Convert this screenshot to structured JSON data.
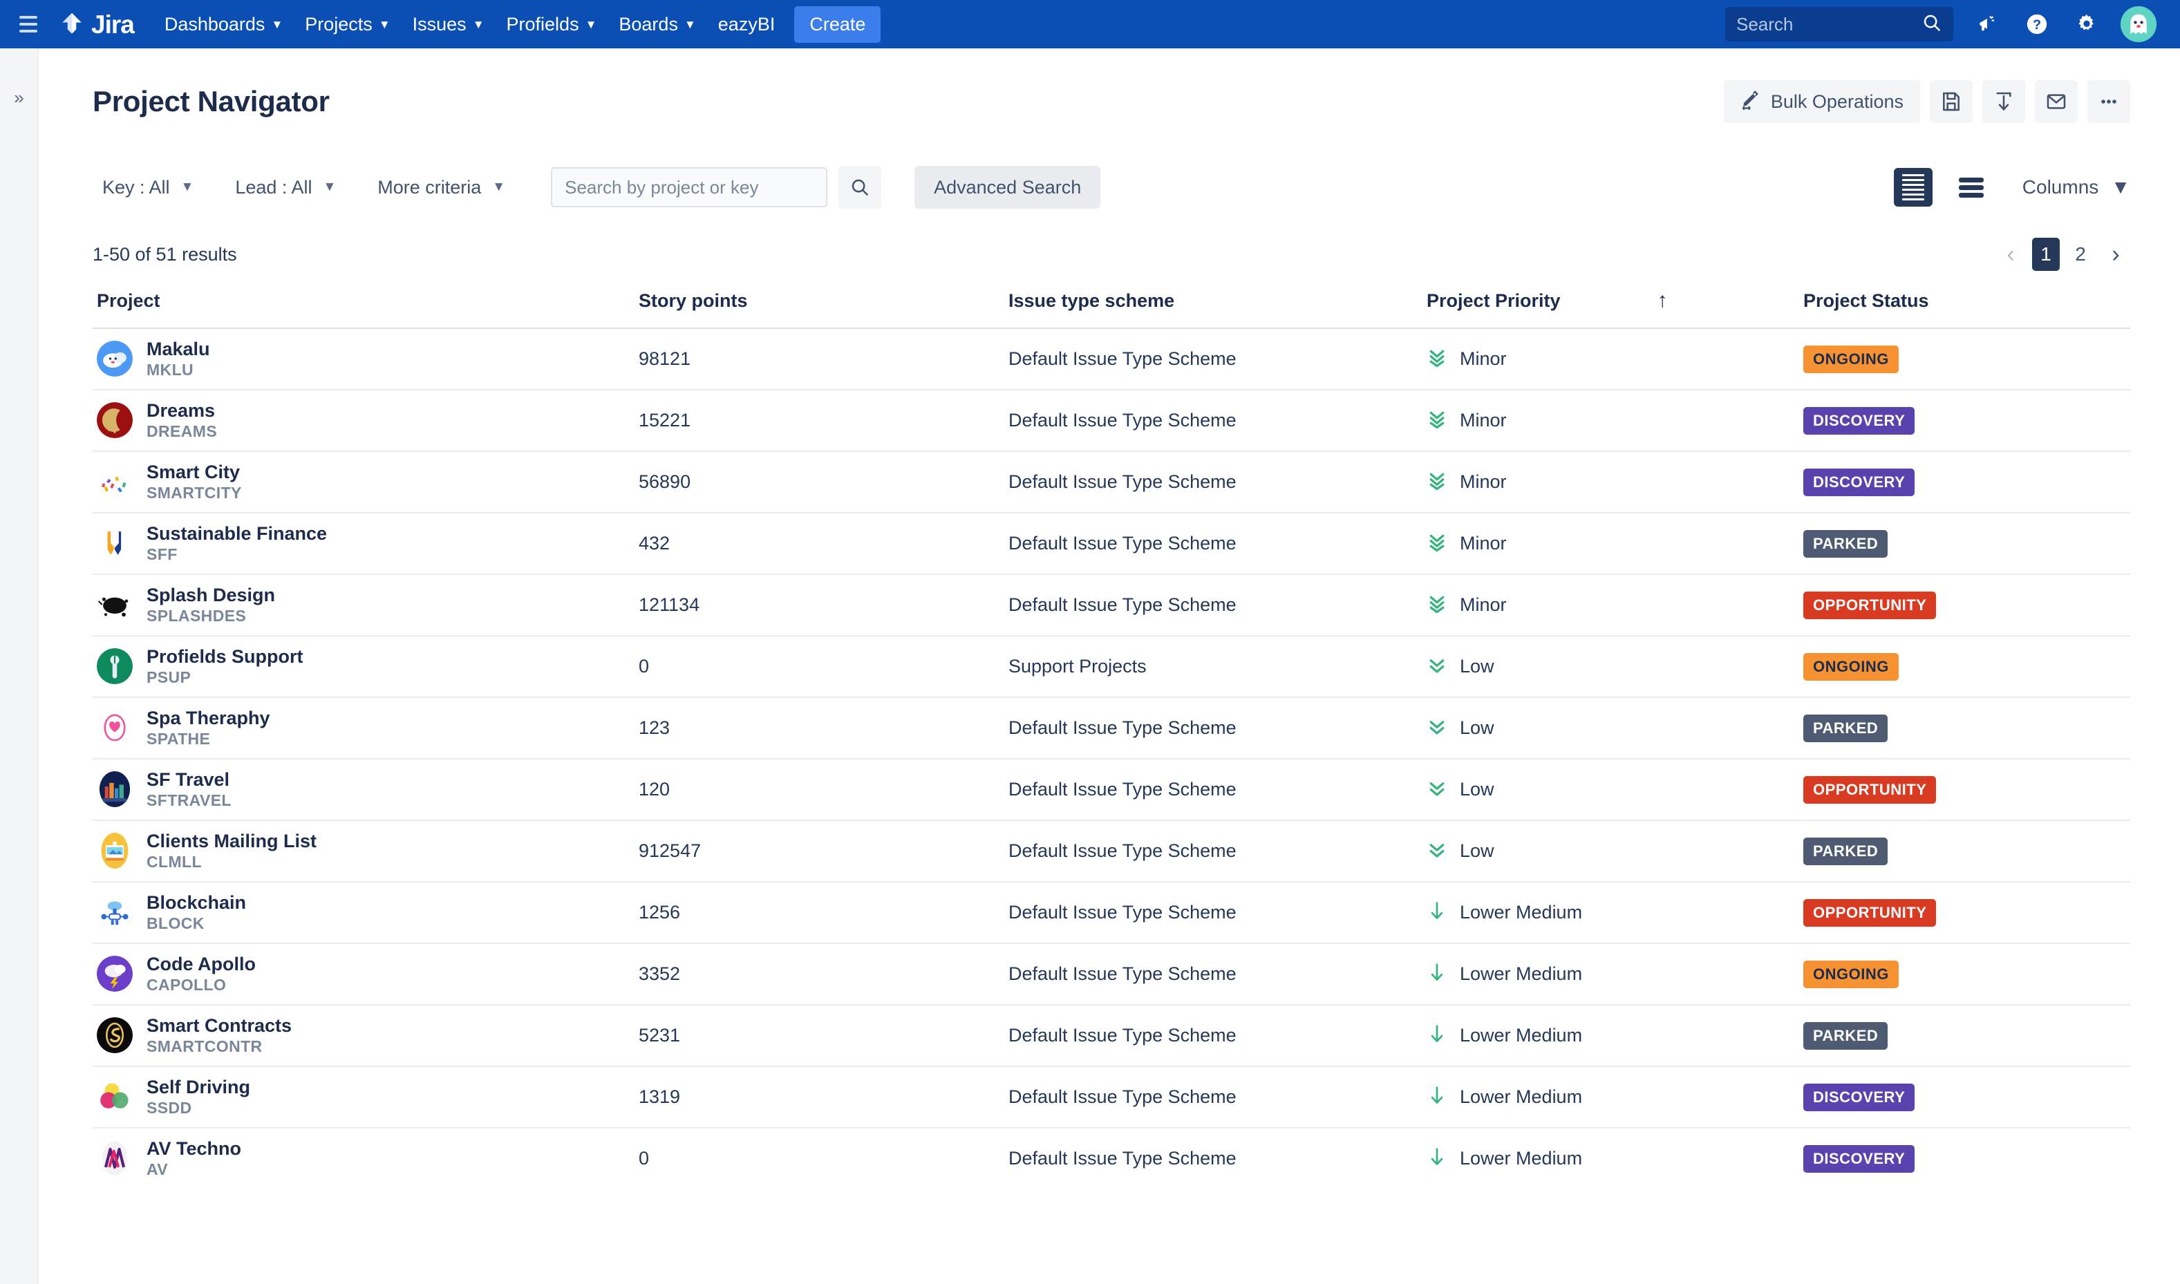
{
  "topnav": {
    "logo_text": "Jira",
    "items": [
      {
        "label": "Dashboards",
        "has_caret": true
      },
      {
        "label": "Projects",
        "has_caret": true
      },
      {
        "label": "Issues",
        "has_caret": true
      },
      {
        "label": "Profields",
        "has_caret": true
      },
      {
        "label": "Boards",
        "has_caret": true
      },
      {
        "label": "eazyBI",
        "has_caret": false
      }
    ],
    "create_label": "Create",
    "search_placeholder": "Search",
    "search_value": "",
    "icons": [
      "megaphone-icon",
      "help-icon",
      "gear-icon",
      "avatar"
    ]
  },
  "leftrail": {
    "expand_glyph": "»"
  },
  "header": {
    "title": "Project Navigator",
    "bulk_operations_label": "Bulk Operations",
    "icon_buttons": [
      "save-icon",
      "export-icon",
      "email-icon",
      "more-icon"
    ]
  },
  "filters": {
    "key": "Key : All",
    "lead": "Lead : All",
    "more": "More criteria",
    "search_placeholder": "Search by project or key",
    "search_value": "",
    "advanced_search": "Advanced Search",
    "columns": "Columns",
    "view_compact_active": true
  },
  "results": {
    "count_text": "1-50 of 51 results",
    "pages": [
      "1",
      "2"
    ],
    "active_page": "1"
  },
  "table": {
    "columns": [
      "Project",
      "Story points",
      "Issue type scheme",
      "Project Priority",
      "Project Status"
    ],
    "sort_column": "Project Priority",
    "sort_direction": "↑",
    "rows": [
      {
        "name": "Makalu",
        "key": "MKLU",
        "points": "98121",
        "scheme": "Default Issue Type Scheme",
        "priority": "Minor",
        "priority_icon": "triple-chevron-down-icon",
        "status": "ONGOING",
        "avatar": "cloud-blue"
      },
      {
        "name": "Dreams",
        "key": "DREAMS",
        "points": "15221",
        "scheme": "Default Issue Type Scheme",
        "priority": "Minor",
        "priority_icon": "triple-chevron-down-icon",
        "status": "DISCOVERY",
        "avatar": "moon-red"
      },
      {
        "name": "Smart City",
        "key": "SMARTCITY",
        "points": "56890",
        "scheme": "Default Issue Type Scheme",
        "priority": "Minor",
        "priority_icon": "triple-chevron-down-icon",
        "status": "DISCOVERY",
        "avatar": "confetti"
      },
      {
        "name": "Sustainable Finance",
        "key": "SFF",
        "points": "432",
        "scheme": "Default Issue Type Scheme",
        "priority": "Minor",
        "priority_icon": "triple-chevron-down-icon",
        "status": "PARKED",
        "avatar": "ribbon-blue-yellow"
      },
      {
        "name": "Splash Design",
        "key": "SPLASHDES",
        "points": "121134",
        "scheme": "Default Issue Type Scheme",
        "priority": "Minor",
        "priority_icon": "triple-chevron-down-icon",
        "status": "OPPORTUNITY",
        "avatar": "splash-black"
      },
      {
        "name": "Profields Support",
        "key": "PSUP",
        "points": "0",
        "scheme": "Support Projects",
        "priority": "Low",
        "priority_icon": "double-chevron-down-icon",
        "status": "ONGOING",
        "avatar": "wrench-green"
      },
      {
        "name": "Spa Theraphy",
        "key": "SPATHE",
        "points": "123",
        "scheme": "Default Issue Type Scheme",
        "priority": "Low",
        "priority_icon": "double-chevron-down-icon",
        "status": "PARKED",
        "avatar": "spa-pink"
      },
      {
        "name": "SF Travel",
        "key": "SFTRAVEL",
        "points": "120",
        "scheme": "Default Issue Type Scheme",
        "priority": "Low",
        "priority_icon": "double-chevron-down-icon",
        "status": "OPPORTUNITY",
        "avatar": "city-navy"
      },
      {
        "name": "Clients Mailing List",
        "key": "CLMLL",
        "points": "912547",
        "scheme": "Default Issue Type Scheme",
        "priority": "Low",
        "priority_icon": "double-chevron-down-icon",
        "status": "PARKED",
        "avatar": "mail-yellow"
      },
      {
        "name": "Blockchain",
        "key": "BLOCK",
        "points": "1256",
        "scheme": "Default Issue Type Scheme",
        "priority": "Lower Medium",
        "priority_icon": "arrow-down-icon",
        "status": "OPPORTUNITY",
        "avatar": "chain-blue"
      },
      {
        "name": "Code Apollo",
        "key": "CAPOLLO",
        "points": "3352",
        "scheme": "Default Issue Type Scheme",
        "priority": "Lower Medium",
        "priority_icon": "arrow-down-icon",
        "status": "ONGOING",
        "avatar": "storm-purple"
      },
      {
        "name": "Smart Contracts",
        "key": "SMARTCONTR",
        "points": "5231",
        "scheme": "Default Issue Type Scheme",
        "priority": "Lower Medium",
        "priority_icon": "arrow-down-icon",
        "status": "PARKED",
        "avatar": "coin-black"
      },
      {
        "name": "Self Driving",
        "key": "SSDD",
        "points": "1319",
        "scheme": "Default Issue Type Scheme",
        "priority": "Lower Medium",
        "priority_icon": "arrow-down-icon",
        "status": "DISCOVERY",
        "avatar": "venn-pink"
      },
      {
        "name": "AV Techno",
        "key": "AV",
        "points": "0",
        "scheme": "Default Issue Type Scheme",
        "priority": "Lower Medium",
        "priority_icon": "arrow-down-icon",
        "status": "DISCOVERY",
        "avatar": "av-magenta"
      }
    ]
  },
  "colors": {
    "nav_blue": "#0B4FB5",
    "create_blue": "#3B7DEB",
    "text_dark": "#1d2b4c",
    "priority_green": "#36B37E",
    "status_ongoing_bg": "#F79232",
    "status_ongoing_fg": "#1d2b4c",
    "status_discovery_bg": "#5A43AE",
    "status_discovery_fg": "#ffffff",
    "status_parked_bg": "#4E5B72",
    "status_parked_fg": "#ffffff",
    "status_opportunity_bg": "#D93B22",
    "status_opportunity_fg": "#ffffff"
  }
}
